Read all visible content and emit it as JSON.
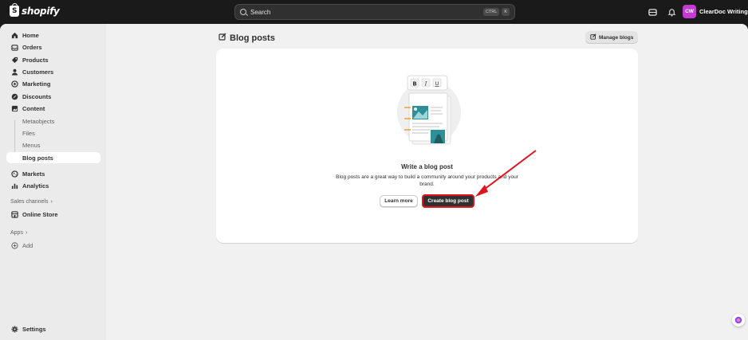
{
  "brand": {
    "name": "shopify"
  },
  "search": {
    "label": "Search",
    "shortcut_keys": [
      "CTRL",
      "K"
    ]
  },
  "account": {
    "initials": "CW",
    "name": "ClearDoc Writing",
    "avatar_color": "#c43bd3"
  },
  "sidebar": {
    "items": [
      {
        "label": "Home",
        "icon": "home-icon"
      },
      {
        "label": "Orders",
        "icon": "inbox-icon"
      },
      {
        "label": "Products",
        "icon": "tag-icon"
      },
      {
        "label": "Customers",
        "icon": "person-icon"
      },
      {
        "label": "Marketing",
        "icon": "target-icon"
      },
      {
        "label": "Discounts",
        "icon": "discount-icon"
      },
      {
        "label": "Content",
        "icon": "image-icon"
      }
    ],
    "content_sub": [
      "Metaobjects",
      "Files",
      "Menus",
      "Blog posts"
    ],
    "active_sub": "Blog posts",
    "items2": [
      {
        "label": "Markets",
        "icon": "globe-icon"
      },
      {
        "label": "Analytics",
        "icon": "bar-chart-icon"
      }
    ],
    "sales_channels_label": "Sales channels",
    "online_store_label": "Online Store",
    "apps_label": "Apps",
    "add_label": "Add",
    "settings_label": "Settings"
  },
  "main": {
    "title": "Blog posts",
    "manage_button": "Manage blogs",
    "empty_state": {
      "heading": "Write a blog post",
      "description": "Blog posts are a great way to build a community around your products and your brand.",
      "secondary_button": "Learn more",
      "primary_button": "Create blog post"
    }
  },
  "colors": {
    "topbar": "#1a1a1a",
    "annotation_red": "#e0141e",
    "primary_button": "#303030"
  }
}
